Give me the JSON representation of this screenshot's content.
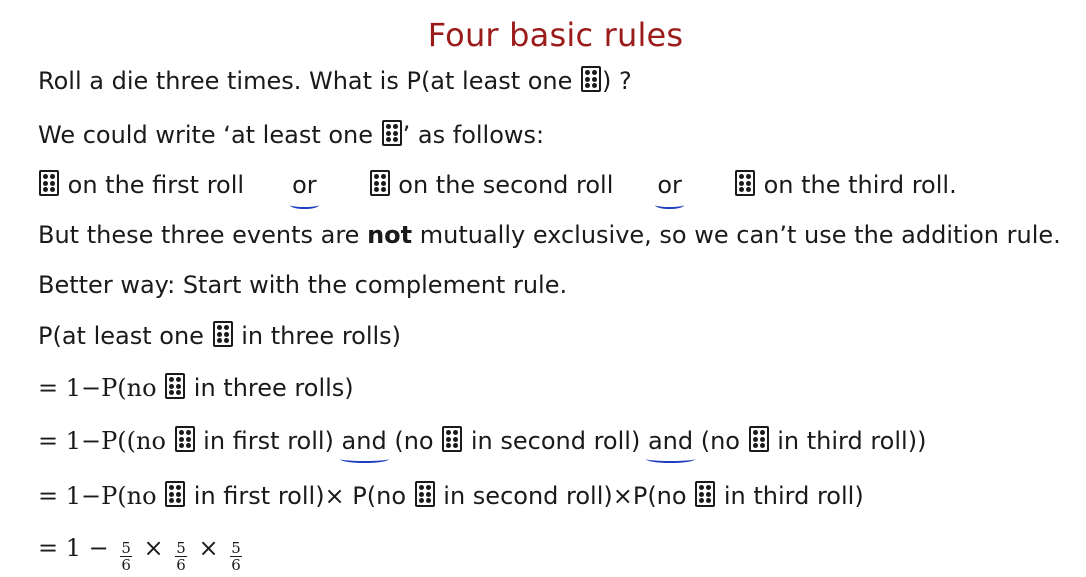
{
  "title": "Four basic rules",
  "l1": {
    "a": "Roll a die three times. What is P(at least one ",
    "b": ") ?"
  },
  "l2": {
    "a": "We could write ‘at least one ",
    "b": "’ as follows:"
  },
  "l3": {
    "a": " on the first roll",
    "or1": "or",
    "b": " on the second roll",
    "or2": "or",
    "c": " on the third roll."
  },
  "l4": {
    "a": "But these three events are ",
    "bold": "not",
    "b": " mutually exclusive, so we can’t use the addition rule."
  },
  "l5": {
    "a": "Better way: Start with the complement rule."
  },
  "l6": {
    "a": "P(at least one ",
    "b": " in three rolls)"
  },
  "l7": {
    "a": "= 1−P(no ",
    "b": " in three rolls)"
  },
  "l8": {
    "a": "= 1−P((no ",
    "b": " in first roll) ",
    "and1": "and",
    "c": " (no ",
    "d": " in second roll) ",
    "and2": "and",
    "e": " (no ",
    "f": " in third roll))"
  },
  "l9": {
    "a": "= 1−P(no ",
    "b": " in first roll)× P(no ",
    "c": " in second roll)×P(no ",
    "d": " in third roll)"
  },
  "l10": {
    "a": "= 1 − ",
    "n1": "5",
    "d1": "6",
    "x1": " × ",
    "n2": "5",
    "d2": "6",
    "x2": " × ",
    "n3": "5",
    "d3": "6"
  },
  "colors": {
    "title": "#9b1b1b",
    "underline": "#1f3fbf"
  },
  "icons": {
    "die": "die-six-icon"
  }
}
